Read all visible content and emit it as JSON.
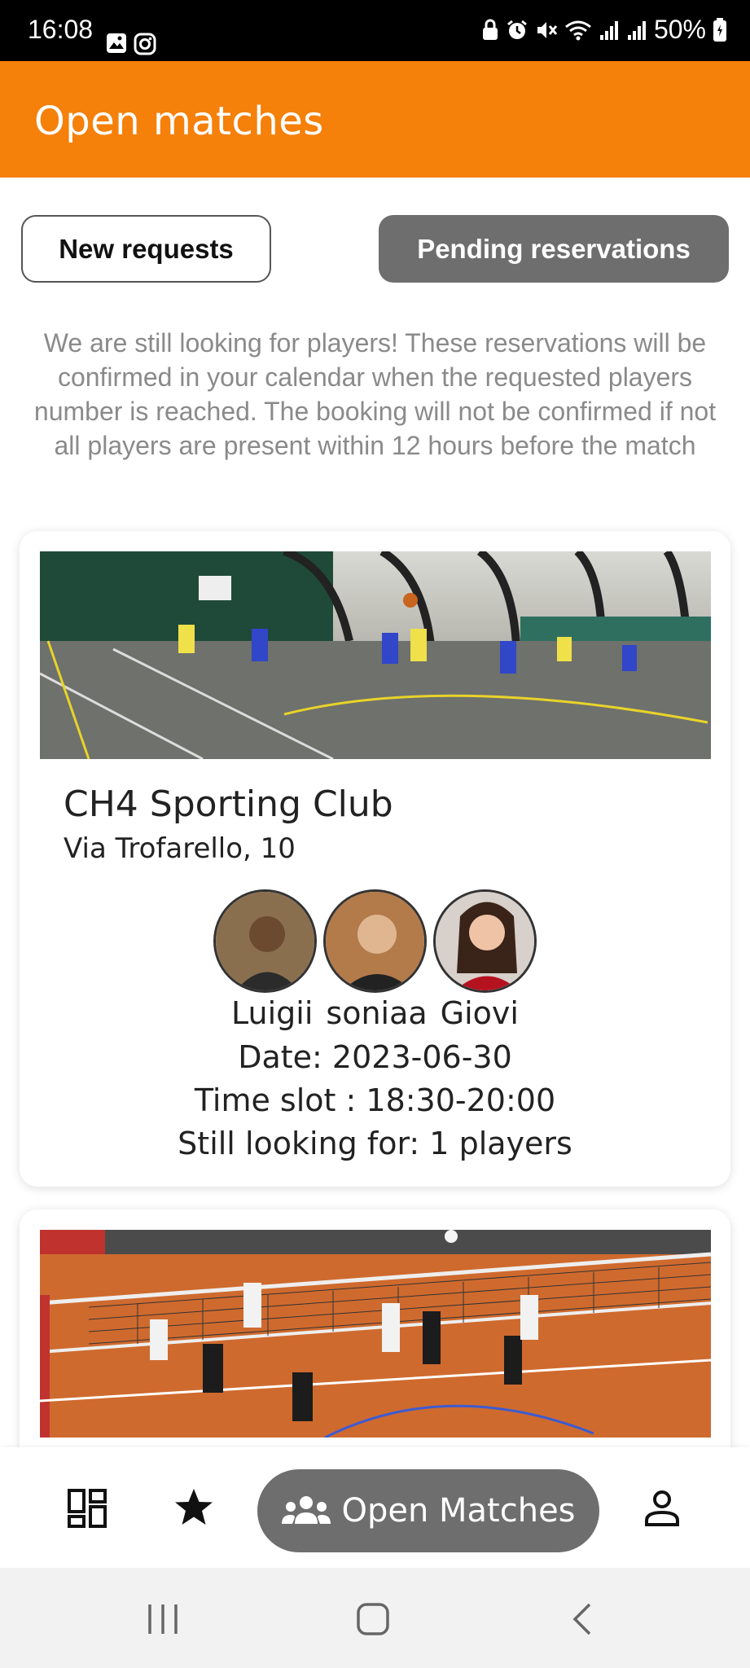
{
  "status_bar": {
    "time": "16:08",
    "battery": "50%",
    "left_icons": [
      "gallery-icon",
      "instagram-icon"
    ],
    "right_icons": [
      "lock-icon",
      "alarm-icon",
      "mute-icon",
      "wifi-icon",
      "signal-icon",
      "signal-icon",
      "battery-icon"
    ]
  },
  "app_bar": {
    "title": "Open matches"
  },
  "tabs": {
    "new_requests": "New requests",
    "pending_reservations": "Pending reservations",
    "selected": "pending_reservations"
  },
  "info_text": "We are still looking for players! These reservations will be confirmed in your calendar when the requested players number is reached. The booking will not be confirmed if not all players are present within 12 hours before the match",
  "matches": [
    {
      "club_name": "CH4 Sporting Club",
      "address": "Via Trofarello, 10",
      "players": [
        "Luigii",
        "soniaa",
        "Giovi"
      ],
      "date": "Date: 2023-06-30",
      "time_slot": "Time slot : 18:30-20:00",
      "still_looking": "Still looking for: 1 players",
      "image": "basketball-court-photo"
    },
    {
      "image": "volleyball-court-photo"
    }
  ],
  "bottom_nav": {
    "items": [
      "dashboard-icon",
      "star-icon",
      "group-icon",
      "person-icon"
    ],
    "active_label": "Open Matches"
  },
  "colors": {
    "primary": "#F5800A",
    "pill": "#6E6E6E",
    "info_text": "#8A8A8A"
  }
}
